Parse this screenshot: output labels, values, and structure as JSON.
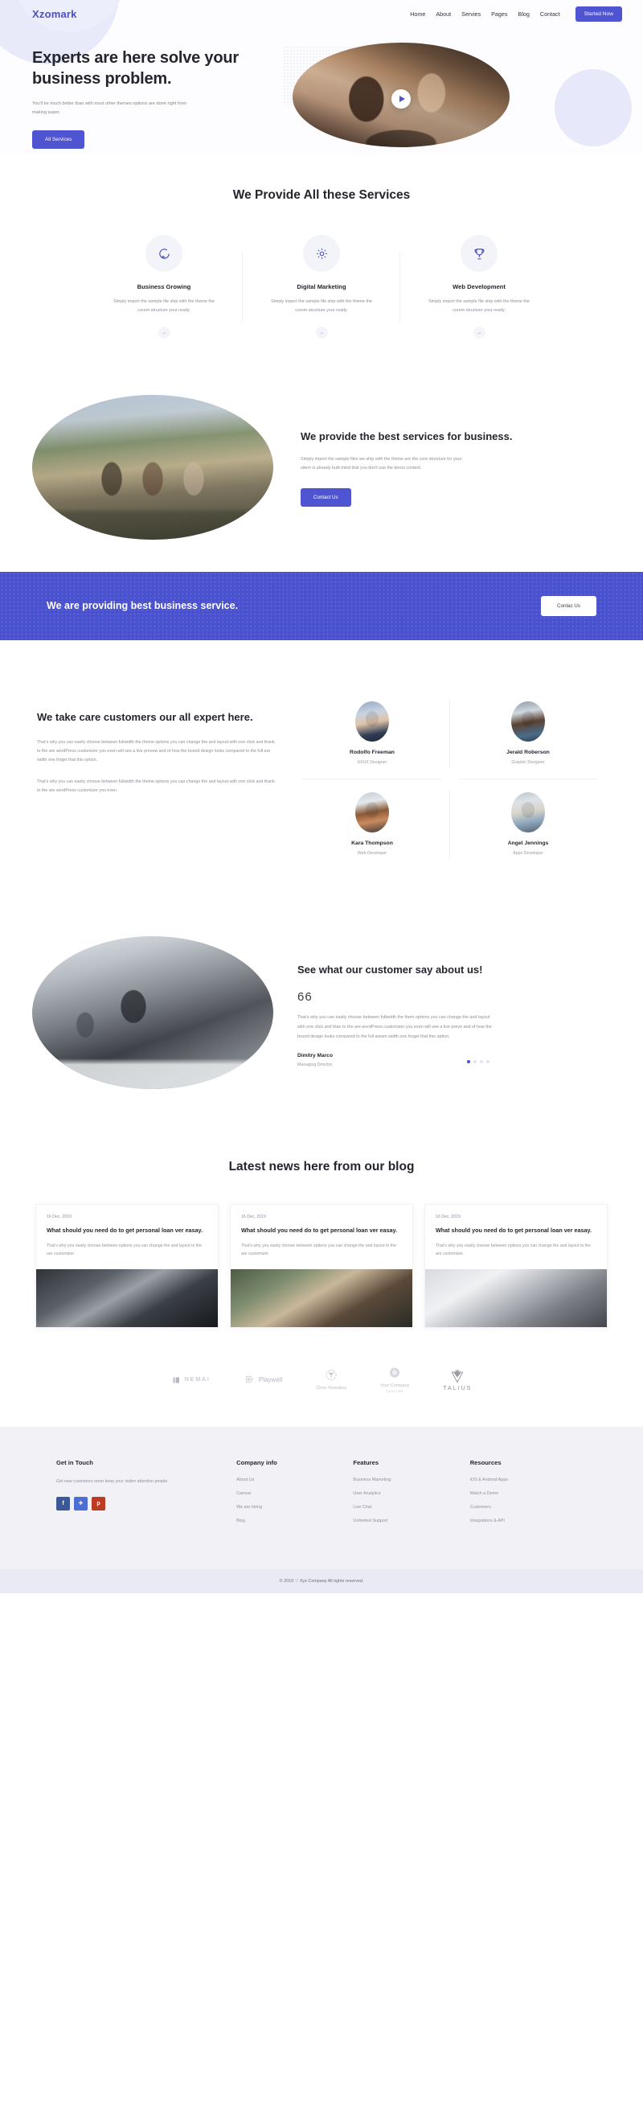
{
  "brand": {
    "name": "Xzomark"
  },
  "nav": {
    "links": [
      {
        "label": "Home"
      },
      {
        "label": "About"
      },
      {
        "label": "Servies"
      },
      {
        "label": "Pages"
      },
      {
        "label": "Blog"
      },
      {
        "label": "Contact"
      }
    ],
    "cta_label": "Started Now"
  },
  "hero": {
    "title": "Experts are here solve your business problem.",
    "subtitle": "You'll be much better than with most other themes options are done right from making super.",
    "button_label": "All Services",
    "play_icon": "play-icon"
  },
  "services": {
    "heading": "We Provide All these Services",
    "cards": [
      {
        "icon": "chat-bubble-icon",
        "title": "Business Growing",
        "desc": "Simply import the sample file ship with the theme the corem structure your ready.",
        "arrow": "→"
      },
      {
        "icon": "gear-icon",
        "title": "Digital Marketing",
        "desc": "Simply import the sample file ship with the theme the corem structure your ready.",
        "arrow": "→"
      },
      {
        "icon": "trophy-icon",
        "title": "Web Development",
        "desc": "Simply import the sample file ship with the theme the corem structure your ready.",
        "arrow": "→"
      }
    ]
  },
  "best": {
    "title": "We provide the best services for business.",
    "desc": "Simply import the sample files we ship with the theme are the core structure for your sitem is already built mind that you don't use the demo content.",
    "button_label": "Contact Us"
  },
  "cta_band": {
    "title": "We are providing best business service.",
    "button_label": "Contac Us"
  },
  "team": {
    "title": "We take care customers our all expert here.",
    "paragraph1": "That's why you can easily choose between fullwidth the theme options you can change the and layout with one click and thank to the are wordPress customizer you even will see a live prevew and of how the boxed design looks compared to the full are width one forget that this option.",
    "paragraph2": "That's why you can easily choose between fullwidth the theme options you can change the and layout with one click and thank to the are wordPress customizer you even.",
    "members": [
      {
        "name": "Rodolfo Freeman",
        "role": "UI/UX Designer"
      },
      {
        "name": "Jerald Roberson",
        "role": "Graphic Designer"
      },
      {
        "name": "Kara Thompson",
        "role": "Web Developer"
      },
      {
        "name": "Angel Jennings",
        "role": "Apps Developer"
      }
    ]
  },
  "testimonial": {
    "title": "See what our customer say about us!",
    "quote_mark": "66",
    "body": "That's why you can easily choose between fullwidth the them options you can change the and layout with one click and than to the are wordPress customizer you even will see a live preve and of how the boxed design looks compared to the full aream width one forget that this option.",
    "name": "Dimitry Marco",
    "role": "Managing Director",
    "dots": [
      true,
      false,
      false,
      false
    ]
  },
  "blog": {
    "heading": "Latest news here from our blog",
    "posts": [
      {
        "date": "16 Dec, 2019",
        "title": "What should you need do to get personal loan ver easay.",
        "desc": "That's why you easily choose between options you can change the and layout to the are customizer."
      },
      {
        "date": "16 Dec, 2019",
        "title": "What should you need do to get personal loan ver easay.",
        "desc": "That's why you easily choose between options you can change the and layout to the are customizer."
      },
      {
        "date": "16 Dec, 2019",
        "title": "What should you need do to get personal loan ver easay.",
        "desc": "That's why you easily choose between options you can change the and layout to the are customizer."
      }
    ]
  },
  "partners": [
    {
      "name": "NEMAI",
      "sub": ""
    },
    {
      "name": "Playwell",
      "sub": ""
    },
    {
      "name": "Chris Yionnikos",
      "sub": ""
    },
    {
      "name": "Your Company",
      "sub": "TAGLINE"
    },
    {
      "name": "TALIUS",
      "sub": ""
    }
  ],
  "footer": {
    "columns": [
      {
        "head": "Get in Touch",
        "desc": "Get new customers orem keep your visitor attention people.",
        "socials": [
          {
            "icon": "facebook-icon",
            "glyph": "f"
          },
          {
            "icon": "twitter-icon",
            "glyph": "✈"
          },
          {
            "icon": "pinterest-icon",
            "glyph": "p"
          }
        ]
      },
      {
        "head": "Company info",
        "links": [
          "About Us",
          "Carrear",
          "We are hiring",
          "Blog"
        ]
      },
      {
        "head": "Features",
        "links": [
          "Business Marketing",
          "User Analytics",
          "Live Chat",
          "Unlimited Support"
        ]
      },
      {
        "head": "Resources",
        "links": [
          "iOS & Android Apps",
          "Watch a Demo",
          "Customers",
          "Integrations & API"
        ]
      }
    ],
    "copyright": "© 2019 ♡ Xyz Company All rights reserved."
  },
  "colors": {
    "accent": "#4f55d1",
    "band": "#4a51cf",
    "text": "#25252f",
    "muted": "#8d8d98"
  }
}
